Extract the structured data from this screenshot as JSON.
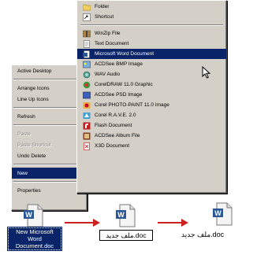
{
  "context_menu": {
    "items": [
      {
        "label": "Active Desktop",
        "submenu": true,
        "disabled": false
      },
      {
        "sep": true
      },
      {
        "label": "Arrange Icons",
        "submenu": true,
        "disabled": false
      },
      {
        "label": "Line Up Icons",
        "submenu": false,
        "disabled": false
      },
      {
        "sep": true
      },
      {
        "label": "Refresh",
        "submenu": false,
        "disabled": false
      },
      {
        "sep": true
      },
      {
        "label": "Paste",
        "submenu": false,
        "disabled": true
      },
      {
        "label": "Paste Shortcut",
        "submenu": false,
        "disabled": true
      },
      {
        "label": "Undo Delete",
        "submenu": false,
        "disabled": false
      },
      {
        "sep": true
      },
      {
        "label": "New",
        "submenu": true,
        "disabled": false,
        "selected": true
      },
      {
        "sep": true
      },
      {
        "label": "Properties",
        "submenu": false,
        "disabled": false
      }
    ]
  },
  "new_menu": {
    "items": [
      {
        "label": "Folder",
        "icon": "folder-icon"
      },
      {
        "label": "Shortcut",
        "icon": "shortcut-icon"
      },
      {
        "sep": true
      },
      {
        "label": "WinZip File",
        "icon": "winzip-icon"
      },
      {
        "label": "Text Document",
        "icon": "text-doc-icon"
      },
      {
        "label": "Microsoft Word Document",
        "icon": "word-doc-icon",
        "selected": true
      },
      {
        "label": "ACDSee BMP Image",
        "icon": "bmp-image-icon"
      },
      {
        "label": "WAV Audio",
        "icon": "wav-audio-icon"
      },
      {
        "label": "CorelDRAW 11.0 Graphic",
        "icon": "coreldraw-icon"
      },
      {
        "label": "ACDSee PSD Image",
        "icon": "psd-image-icon"
      },
      {
        "label": "Corel PHOTO-PAINT 11.0 Image",
        "icon": "photopaint-icon"
      },
      {
        "label": "Corel R.A.V.E. 2.0",
        "icon": "corel-rave-icon"
      },
      {
        "label": "Flash Document",
        "icon": "flash-doc-icon"
      },
      {
        "label": "ACDSee Album File",
        "icon": "album-file-icon"
      },
      {
        "label": "X3D Document",
        "icon": "x3d-doc-icon"
      }
    ]
  },
  "files": [
    {
      "label": "New Microsoft Word Document.doc",
      "state": "selected"
    },
    {
      "label": "ملف جديد.doc",
      "state": "renaming"
    },
    {
      "label": "ملف جديد.doc",
      "state": "renamed"
    }
  ],
  "colors": {
    "highlight": "#0a246a",
    "menu_bg": "#d4d0c8",
    "arrow": "#cc2020",
    "word_blue": "#2b5797"
  }
}
